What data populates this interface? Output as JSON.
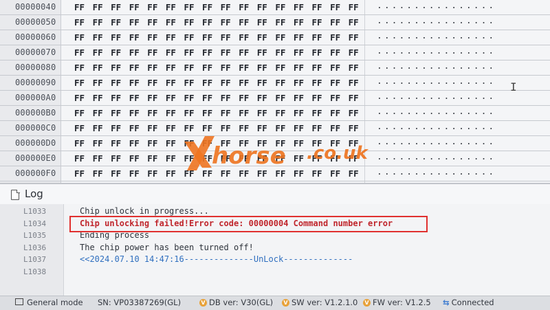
{
  "hex": {
    "rows": [
      {
        "addr": "00000040",
        "bytes": "FF FF FF FF FF FF FF FF FF FF FF FF FF FF FF FF",
        "ascii": "................"
      },
      {
        "addr": "00000050",
        "bytes": "FF FF FF FF FF FF FF FF FF FF FF FF FF FF FF FF",
        "ascii": "................"
      },
      {
        "addr": "00000060",
        "bytes": "FF FF FF FF FF FF FF FF FF FF FF FF FF FF FF FF",
        "ascii": "................"
      },
      {
        "addr": "00000070",
        "bytes": "FF FF FF FF FF FF FF FF FF FF FF FF FF FF FF FF",
        "ascii": "................"
      },
      {
        "addr": "00000080",
        "bytes": "FF FF FF FF FF FF FF FF FF FF FF FF FF FF FF FF",
        "ascii": "................"
      },
      {
        "addr": "00000090",
        "bytes": "FF FF FF FF FF FF FF FF FF FF FF FF FF FF FF FF",
        "ascii": "................"
      },
      {
        "addr": "000000A0",
        "bytes": "FF FF FF FF FF FF FF FF FF FF FF FF FF FF FF FF",
        "ascii": "................"
      },
      {
        "addr": "000000B0",
        "bytes": "FF FF FF FF FF FF FF FF FF FF FF FF FF FF FF FF",
        "ascii": "................"
      },
      {
        "addr": "000000C0",
        "bytes": "FF FF FF FF FF FF FF FF FF FF FF FF FF FF FF FF",
        "ascii": "................"
      },
      {
        "addr": "000000D0",
        "bytes": "FF FF FF FF FF FF FF FF FF FF FF FF FF FF FF FF",
        "ascii": "................"
      },
      {
        "addr": "000000E0",
        "bytes": "FF FF FF FF FF FF FF FF FF FF FF FF FF FF FF FF",
        "ascii": "................"
      },
      {
        "addr": "000000F0",
        "bytes": "FF FF FF FF FF FF FF FF FF FF FF FF FF FF FF FF",
        "ascii": "................"
      }
    ]
  },
  "watermark": {
    "brand": "Xhorse",
    "domain": ".co.uk",
    "color": "#ee7420"
  },
  "log": {
    "title": "Log",
    "icon": "document-icon",
    "lines": [
      {
        "num": "L1033",
        "text": "Chip unlock in progress...",
        "kind": "normal"
      },
      {
        "num": "L1034",
        "text": "Chip unlocking failed!Error code: 00000004 Command number error",
        "kind": "error"
      },
      {
        "num": "L1035",
        "text": "Ending process",
        "kind": "normal"
      },
      {
        "num": "L1036",
        "text": "The chip power has been turned off!",
        "kind": "normal"
      },
      {
        "num": "L1037",
        "text": "<<2024.07.10 14:47:16--------------UnLock--------------",
        "kind": "link"
      },
      {
        "num": "L1038",
        "text": "",
        "kind": "normal"
      }
    ]
  },
  "status_bar": {
    "mode": "General mode",
    "sn": "SN:  VP03387269(GL)",
    "db_ver": "DB ver: V30(GL)",
    "sw_ver": "SW ver: V1.2.1.0",
    "fw_ver": "FW ver: V1.2.5",
    "connection": "Connected",
    "version_badge": "V"
  },
  "colors": {
    "error": "#c0262c",
    "highlight_box": "#e0302f",
    "link": "#2f6fbf"
  }
}
